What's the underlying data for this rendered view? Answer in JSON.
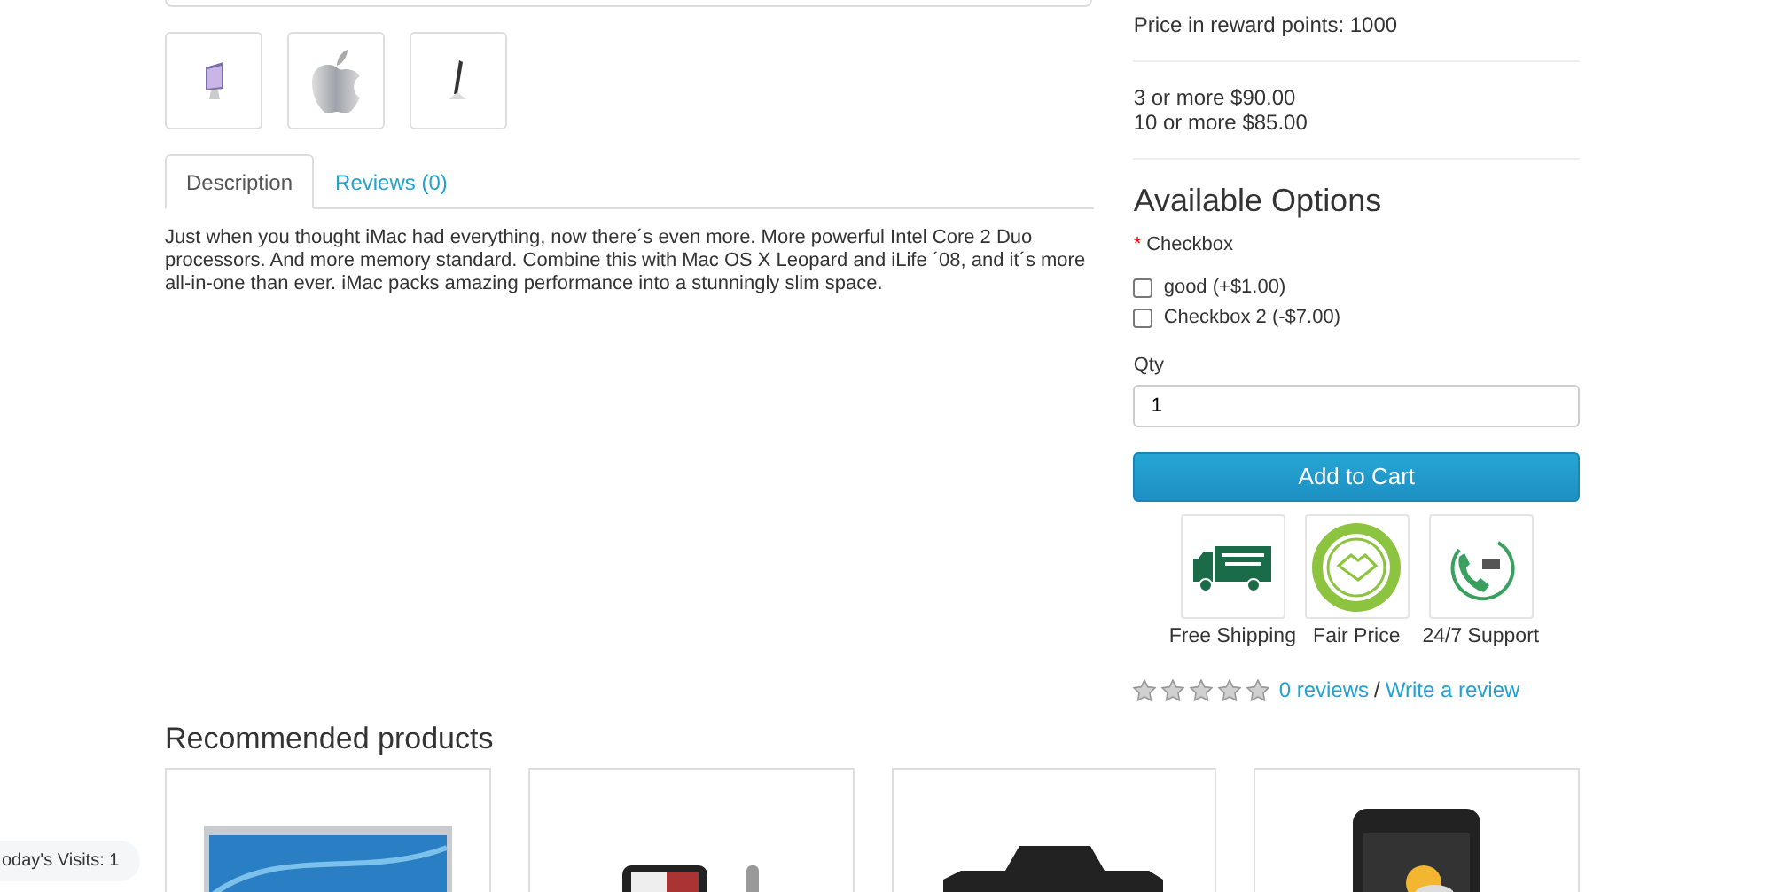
{
  "thumbnails": [
    {
      "kind": "imac"
    },
    {
      "kind": "apple"
    },
    {
      "kind": "side"
    }
  ],
  "tabs": [
    {
      "label": "Description",
      "selected": true
    },
    {
      "label": "Reviews (0)",
      "selected": false
    }
  ],
  "description": "Just when you thought iMac had everything, now there´s even more. More powerful Intel Core 2 Duo processors. And more memory standard. Combine this with Mac OS X Leopard and iLife ´08, and it´s more all-in-one than ever. iMac packs amazing performance into a stunningly slim space.",
  "reward_points": "Price in reward points: 1000",
  "discounts": [
    "3 or more $90.00",
    "10 or more $85.00"
  ],
  "options": {
    "title": "Available Options",
    "required_mark": "*",
    "label": "Checkbox",
    "choices": [
      {
        "label": "good (+$1.00)",
        "checked": false
      },
      {
        "label": "Checkbox 2 (-$7.00)",
        "checked": false
      }
    ]
  },
  "qty": {
    "label": "Qty",
    "value": "1"
  },
  "add_to_cart": "Add to Cart",
  "badges": [
    {
      "kind": "truck",
      "label": "Free Shipping"
    },
    {
      "kind": "seal",
      "label": "Fair Price"
    },
    {
      "kind": "phone",
      "label": "24/7 Support"
    }
  ],
  "rating": {
    "stars": 0,
    "reviews_link": "0 reviews",
    "separator": "/",
    "write_link": "Write a review"
  },
  "recommended": {
    "title": "Recommended products",
    "products": [
      {
        "kind": "laptop"
      },
      {
        "kind": "player"
      },
      {
        "kind": "camera"
      },
      {
        "kind": "phone"
      }
    ]
  },
  "visits": "oday's Visits: 1"
}
